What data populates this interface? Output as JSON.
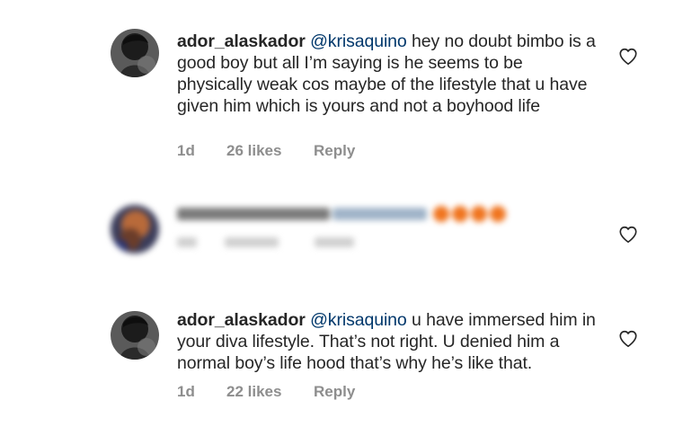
{
  "comments": [
    {
      "username": "ador_alaskador",
      "mention": "@krisaquino",
      "text": " hey no doubt bimbo is a good boy but all I’m saying is he seems to be physically weak cos maybe of the lifestyle that u have given him which is yours and not a boyhood life",
      "time": "1d",
      "likes": "26 likes",
      "reply": "Reply"
    },
    {
      "blurred": true
    },
    {
      "username": "ador_alaskador",
      "mention": "@krisaquino",
      "text": " u have immersed him in your diva lifestyle. That’s not right. U denied him a normal boy’s life hood that’s why he’s like that.",
      "time": "1d",
      "likes": "22 likes",
      "reply": "Reply"
    }
  ],
  "icons": {
    "avatar": "avatar-photo",
    "like": "heart-outline-icon"
  },
  "colors": {
    "username": "#262626",
    "mention": "#00376b",
    "meta": "#8e8e8e",
    "heart_stroke": "#262626",
    "blur_accent": "#f0741e"
  }
}
